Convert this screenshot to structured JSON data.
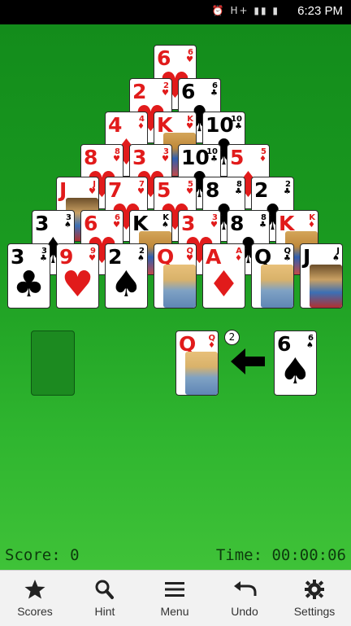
{
  "status_bar": {
    "time": "6:23 PM",
    "icons": "⏰ H+ ▮▮ ▮"
  },
  "pyramid": {
    "row1": [
      {
        "rank": "6",
        "suit": "♥",
        "color": "red",
        "face": ""
      }
    ],
    "row2": [
      {
        "rank": "2",
        "suit": "♥",
        "color": "red",
        "face": ""
      },
      {
        "rank": "6",
        "suit": "♣",
        "color": "black",
        "face": ""
      }
    ],
    "row3": [
      {
        "rank": "4",
        "suit": "♦",
        "color": "red",
        "face": ""
      },
      {
        "rank": "K",
        "suit": "♥",
        "color": "red",
        "face": "king"
      },
      {
        "rank": "10",
        "suit": "♣",
        "color": "black",
        "face": ""
      }
    ],
    "row4": [
      {
        "rank": "8",
        "suit": "♥",
        "color": "red",
        "face": ""
      },
      {
        "rank": "3",
        "suit": "♥",
        "color": "red",
        "face": ""
      },
      {
        "rank": "10",
        "suit": "♣",
        "color": "black",
        "face": ""
      },
      {
        "rank": "5",
        "suit": "♦",
        "color": "red",
        "face": ""
      }
    ],
    "row5": [
      {
        "rank": "J",
        "suit": "♥",
        "color": "red",
        "face": "jack"
      },
      {
        "rank": "7",
        "suit": "♥",
        "color": "red",
        "face": ""
      },
      {
        "rank": "5",
        "suit": "♥",
        "color": "red",
        "face": ""
      },
      {
        "rank": "8",
        "suit": "♣",
        "color": "black",
        "face": ""
      },
      {
        "rank": "2",
        "suit": "♣",
        "color": "black",
        "face": ""
      }
    ],
    "row6": [
      {
        "rank": "3",
        "suit": "♠",
        "color": "black",
        "face": ""
      },
      {
        "rank": "6",
        "suit": "♥",
        "color": "red",
        "face": ""
      },
      {
        "rank": "K",
        "suit": "♠",
        "color": "black",
        "face": "king"
      },
      {
        "rank": "3",
        "suit": "♥",
        "color": "red",
        "face": ""
      },
      {
        "rank": "8",
        "suit": "♣",
        "color": "black",
        "face": ""
      },
      {
        "rank": "K",
        "suit": "♦",
        "color": "red",
        "face": "king"
      }
    ],
    "row7": [
      {
        "rank": "3",
        "suit": "♣",
        "color": "black",
        "face": ""
      },
      {
        "rank": "9",
        "suit": "♥",
        "color": "red",
        "face": ""
      },
      {
        "rank": "2",
        "suit": "♠",
        "color": "black",
        "face": ""
      },
      {
        "rank": "Q",
        "suit": "♥",
        "color": "red",
        "face": "queen"
      },
      {
        "rank": "A",
        "suit": "♦",
        "color": "red",
        "face": ""
      },
      {
        "rank": "Q",
        "suit": "♣",
        "color": "black",
        "face": "queen"
      },
      {
        "rank": "J",
        "suit": "♠",
        "color": "black",
        "face": "jack"
      }
    ]
  },
  "waste_card": {
    "rank": "Q",
    "suit": "♦",
    "color": "red",
    "face": "queen"
  },
  "stock_top_card": {
    "rank": "6",
    "suit": "♠",
    "color": "black",
    "face": ""
  },
  "remaining_passes": "2",
  "score": "Score: 0",
  "time": "Time: 00:00:06",
  "toolbar": [
    {
      "label": "Scores",
      "icon": "star-icon"
    },
    {
      "label": "Hint",
      "icon": "search-icon"
    },
    {
      "label": "Menu",
      "icon": "menu-icon"
    },
    {
      "label": "Undo",
      "icon": "undo-icon"
    },
    {
      "label": "Settings",
      "icon": "gear-icon"
    }
  ],
  "colors": {
    "felt": "#1a9a20",
    "red_suit": "#e11b1b",
    "toolbar_bg": "#f2f2f2"
  }
}
